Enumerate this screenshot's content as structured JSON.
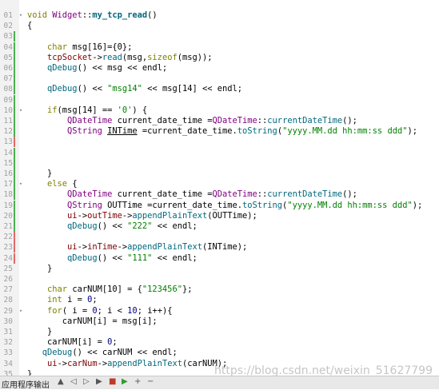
{
  "colors": {
    "keyword": "#808000",
    "type": "#800080",
    "function": "#00677c",
    "string": "#008000",
    "change_added": "#4caf50",
    "change_modified": "#e06b6b"
  },
  "lines": [
    {
      "n": "01",
      "bar": "",
      "fold": "collapse-icon",
      "tokens": [
        [
          "kw",
          "void "
        ],
        [
          "ty",
          "Widget"
        ],
        [
          "",
          "::"
        ],
        [
          "fn bold",
          "my_tcp_read"
        ],
        [
          "",
          "()"
        ]
      ]
    },
    {
      "n": "02",
      "bar": "",
      "fold": "",
      "tokens": [
        [
          "",
          "{"
        ]
      ]
    },
    {
      "n": "03",
      "bar": "green",
      "fold": "",
      "tokens": []
    },
    {
      "n": "04",
      "bar": "green",
      "fold": "",
      "tokens": [
        [
          "",
          "    "
        ],
        [
          "kw",
          "char "
        ],
        [
          "",
          "msg[16]={0};"
        ]
      ]
    },
    {
      "n": "05",
      "bar": "green",
      "fold": "",
      "tokens": [
        [
          "",
          "    "
        ],
        [
          "mem",
          "tcpSocket"
        ],
        [
          "",
          "->"
        ],
        [
          "fn",
          "read"
        ],
        [
          "",
          "(msg,"
        ],
        [
          "kw",
          "sizeof"
        ],
        [
          "",
          "(msg));"
        ]
      ]
    },
    {
      "n": "06",
      "bar": "green",
      "fold": "",
      "tokens": [
        [
          "",
          "    "
        ],
        [
          "fn",
          "qDebug"
        ],
        [
          "",
          "() << msg << endl;"
        ]
      ]
    },
    {
      "n": "07",
      "bar": "green",
      "fold": "",
      "tokens": []
    },
    {
      "n": "08",
      "bar": "green",
      "fold": "",
      "tokens": [
        [
          "",
          "    "
        ],
        [
          "fn",
          "qDebug"
        ],
        [
          "",
          "() << "
        ],
        [
          "str",
          "\"msg14\""
        ],
        [
          "",
          " << msg[14] << endl;"
        ]
      ]
    },
    {
      "n": "09",
      "bar": "green",
      "fold": "",
      "tokens": []
    },
    {
      "n": "10",
      "bar": "green",
      "fold": "collapse-icon",
      "tokens": [
        [
          "",
          "    "
        ],
        [
          "kw",
          "if"
        ],
        [
          "",
          "(msg[14] == "
        ],
        [
          "str",
          "'0'"
        ],
        [
          "",
          ") {"
        ]
      ]
    },
    {
      "n": "11",
      "bar": "green",
      "fold": "",
      "tokens": [
        [
          "",
          "        "
        ],
        [
          "ty",
          "QDateTime "
        ],
        [
          "",
          "current_date_time ="
        ],
        [
          "ty",
          "QDateTime"
        ],
        [
          "",
          "::"
        ],
        [
          "fn",
          "currentDateTime"
        ],
        [
          "",
          "();"
        ]
      ]
    },
    {
      "n": "12",
      "bar": "green",
      "fold": "",
      "tokens": [
        [
          "",
          "        "
        ],
        [
          "ty",
          "QString "
        ],
        [
          "ul",
          "INTime"
        ],
        [
          "",
          " =current_date_time."
        ],
        [
          "fn",
          "toString"
        ],
        [
          "",
          "("
        ],
        [
          "str",
          "\"yyyy.MM.dd hh:mm:ss ddd\""
        ],
        [
          "",
          ");"
        ]
      ]
    },
    {
      "n": "13",
      "bar": "red",
      "fold": "",
      "tokens": []
    },
    {
      "n": "14",
      "bar": "green",
      "fold": "",
      "tokens": []
    },
    {
      "n": "15",
      "bar": "green",
      "fold": "",
      "tokens": []
    },
    {
      "n": "16",
      "bar": "green",
      "fold": "",
      "tokens": [
        [
          "",
          "    }"
        ]
      ]
    },
    {
      "n": "17",
      "bar": "green",
      "fold": "collapse-icon",
      "tokens": [
        [
          "",
          "    "
        ],
        [
          "kw",
          "else"
        ],
        [
          "",
          " {"
        ]
      ]
    },
    {
      "n": "18",
      "bar": "green",
      "fold": "",
      "tokens": [
        [
          "",
          "        "
        ],
        [
          "ty",
          "QDateTime "
        ],
        [
          "",
          "current_date_time ="
        ],
        [
          "ty",
          "QDateTime"
        ],
        [
          "",
          "::"
        ],
        [
          "fn",
          "currentDateTime"
        ],
        [
          "",
          "();"
        ]
      ]
    },
    {
      "n": "19",
      "bar": "green",
      "fold": "",
      "tokens": [
        [
          "",
          "        "
        ],
        [
          "ty",
          "QString "
        ],
        [
          "",
          "OUTTime =current_date_time."
        ],
        [
          "fn",
          "toString"
        ],
        [
          "",
          "("
        ],
        [
          "str",
          "\"yyyy.MM.dd hh:mm:ss ddd\""
        ],
        [
          "",
          ");"
        ]
      ]
    },
    {
      "n": "20",
      "bar": "green",
      "fold": "",
      "tokens": [
        [
          "",
          "        "
        ],
        [
          "mem",
          "ui"
        ],
        [
          "",
          "->"
        ],
        [
          "mem",
          "outTime"
        ],
        [
          "",
          "->"
        ],
        [
          "fn",
          "appendPlainText"
        ],
        [
          "",
          "(OUTTime);"
        ]
      ]
    },
    {
      "n": "21",
      "bar": "green",
      "fold": "",
      "tokens": [
        [
          "",
          "        "
        ],
        [
          "fn",
          "qDebug"
        ],
        [
          "",
          "() << "
        ],
        [
          "str",
          "\"222\""
        ],
        [
          "",
          " << endl;"
        ]
      ]
    },
    {
      "n": "22",
      "bar": "red",
      "fold": "",
      "tokens": []
    },
    {
      "n": "23",
      "bar": "red",
      "fold": "",
      "tokens": [
        [
          "",
          "        "
        ],
        [
          "mem",
          "ui"
        ],
        [
          "",
          "->"
        ],
        [
          "mem",
          "inTime"
        ],
        [
          "",
          "->"
        ],
        [
          "fn",
          "appendPlainText"
        ],
        [
          "",
          "(INTime);"
        ]
      ]
    },
    {
      "n": "24",
      "bar": "red",
      "fold": "",
      "tokens": [
        [
          "",
          "        "
        ],
        [
          "fn",
          "qDebug"
        ],
        [
          "",
          "() << "
        ],
        [
          "str",
          "\"111\""
        ],
        [
          "",
          " << endl;"
        ]
      ]
    },
    {
      "n": "25",
      "bar": "",
      "fold": "",
      "tokens": [
        [
          "",
          "    }"
        ]
      ]
    },
    {
      "n": "26",
      "bar": "",
      "fold": "",
      "tokens": []
    },
    {
      "n": "27",
      "bar": "",
      "fold": "",
      "tokens": [
        [
          "",
          "    "
        ],
        [
          "kw",
          "char "
        ],
        [
          "",
          "carNUM[10] = {"
        ],
        [
          "str",
          "\"123456\""
        ],
        [
          "",
          "};"
        ]
      ]
    },
    {
      "n": "28",
      "bar": "",
      "fold": "",
      "tokens": [
        [
          "",
          "    "
        ],
        [
          "kw",
          "int "
        ],
        [
          "",
          "i = "
        ],
        [
          "num",
          "0"
        ],
        [
          "",
          ";"
        ]
      ]
    },
    {
      "n": "29",
      "bar": "",
      "fold": "collapse-icon",
      "tokens": [
        [
          "",
          "    "
        ],
        [
          "kw",
          "for"
        ],
        [
          "",
          "( i = "
        ],
        [
          "num",
          "0"
        ],
        [
          "",
          "; i < "
        ],
        [
          "num",
          "10"
        ],
        [
          "",
          "; i++){"
        ]
      ]
    },
    {
      "n": "30",
      "bar": "",
      "fold": "",
      "tokens": [
        [
          "",
          "       carNUM[i] = msg[i];"
        ]
      ]
    },
    {
      "n": "31",
      "bar": "",
      "fold": "",
      "tokens": [
        [
          "",
          "    }"
        ]
      ]
    },
    {
      "n": "32",
      "bar": "",
      "fold": "",
      "tokens": [
        [
          "",
          "    carNUM[i] = "
        ],
        [
          "num",
          "0"
        ],
        [
          "",
          ";"
        ]
      ]
    },
    {
      "n": "33",
      "bar": "",
      "fold": "",
      "tokens": [
        [
          "",
          "   "
        ],
        [
          "fn",
          "qDebug"
        ],
        [
          "",
          "() << carNUM << endl;"
        ]
      ]
    },
    {
      "n": "34",
      "bar": "",
      "fold": "",
      "tokens": [
        [
          "",
          "    "
        ],
        [
          "mem",
          "ui"
        ],
        [
          "",
          "->"
        ],
        [
          "mem",
          "carNum"
        ],
        [
          "",
          "->"
        ],
        [
          "fn",
          "appendPlainText"
        ],
        [
          "",
          "(carNUM);"
        ]
      ]
    },
    {
      "n": "35",
      "bar": "",
      "fold": "",
      "tokens": [
        [
          "",
          "}"
        ]
      ]
    }
  ],
  "watermark": "https://blog.csdn.net/weixin_51627799",
  "bottom_panel": {
    "title": "应用程序输出",
    "tools": [
      {
        "icon": "up-arrow-icon",
        "glyph": "▲"
      },
      {
        "icon": "left-arrow-icon",
        "glyph": "◁"
      },
      {
        "icon": "right-arrow-icon",
        "glyph": "▷"
      },
      {
        "icon": "run-icon",
        "glyph": "▶"
      },
      {
        "icon": "stop-icon",
        "glyph": "■"
      },
      {
        "icon": "debug-run-icon",
        "glyph": "▶"
      },
      {
        "icon": "add-icon",
        "glyph": "+"
      },
      {
        "icon": "minimize-icon",
        "glyph": "−"
      }
    ]
  }
}
